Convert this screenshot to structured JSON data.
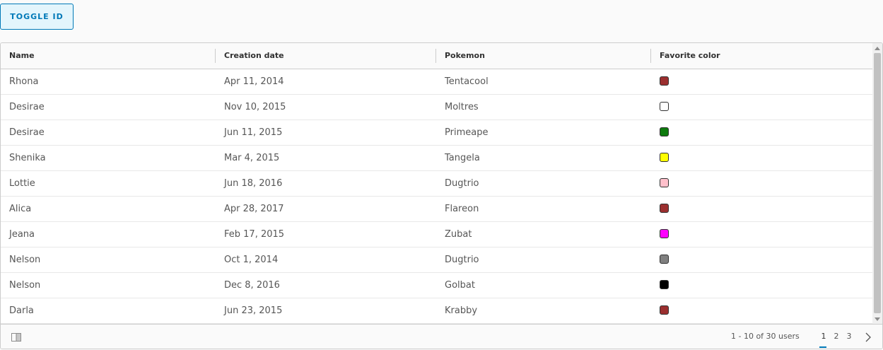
{
  "toolbar": {
    "toggle_label": "Toggle ID"
  },
  "columns": [
    "Name",
    "Creation date",
    "Pokemon",
    "Favorite color"
  ],
  "rows": [
    {
      "name": "Rhona",
      "date": "Apr 11, 2014",
      "pokemon": "Tentacool",
      "color": "#9b2f2f"
    },
    {
      "name": "Desirae",
      "date": "Nov 10, 2015",
      "pokemon": "Moltres",
      "color": "#ffffff"
    },
    {
      "name": "Desirae",
      "date": "Jun 11, 2015",
      "pokemon": "Primeape",
      "color": "#0d7a0d"
    },
    {
      "name": "Shenika",
      "date": "Mar 4, 2015",
      "pokemon": "Tangela",
      "color": "#ffff00"
    },
    {
      "name": "Lottie",
      "date": "Jun 18, 2016",
      "pokemon": "Dugtrio",
      "color": "#ffc0cb"
    },
    {
      "name": "Alica",
      "date": "Apr 28, 2017",
      "pokemon": "Flareon",
      "color": "#9b2f2f"
    },
    {
      "name": "Jeana",
      "date": "Feb 17, 2015",
      "pokemon": "Zubat",
      "color": "#ff00ff"
    },
    {
      "name": "Nelson",
      "date": "Oct 1, 2014",
      "pokemon": "Dugtrio",
      "color": "#808080"
    },
    {
      "name": "Nelson",
      "date": "Dec 8, 2016",
      "pokemon": "Golbat",
      "color": "#000000"
    },
    {
      "name": "Darla",
      "date": "Jun 23, 2015",
      "pokemon": "Krabby",
      "color": "#9b2f2f"
    }
  ],
  "footer": {
    "description": "1 - 10 of 30 users",
    "pages": [
      "1",
      "2",
      "3"
    ],
    "current_page": "1",
    "column_toggle_icon": "column-toggle-icon",
    "next_icon": "chevron-right-icon"
  },
  "colors": {
    "accent": "#0079b8"
  }
}
